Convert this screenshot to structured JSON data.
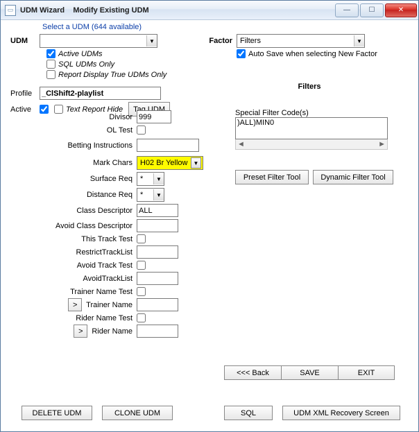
{
  "window": {
    "app_name": "UDM Wizard",
    "subtitle": "Modify Existing UDM"
  },
  "header": {
    "select_link": "Select a UDM (644 available)",
    "udm_label": "UDM",
    "factor_label": "Factor",
    "factor_value": "Filters",
    "udm_value": ""
  },
  "chk_opts": {
    "active_udms": "Active UDMs",
    "sql_only": "SQL UDMs Only",
    "report_display": "Report Display True UDMs Only",
    "autosave": "Auto Save when selecting New Factor"
  },
  "profile": {
    "label": "Profile",
    "value": "_ClShift2-playlist"
  },
  "active": {
    "label": "Active",
    "text_report_hide": "Text Report Hide",
    "tag_btn": "Tag UDM"
  },
  "filters_panel": {
    "title": "Filters",
    "special_label": "Special Filter Code(s)",
    "special_value": ")ALL)MIN0",
    "preset_btn": "Preset Filter Tool",
    "dynamic_btn": "Dynamic Filter Tool"
  },
  "fields": {
    "divisor_label": "Divisor",
    "divisor_value": "999",
    "ol_test_label": "OL Test",
    "betting_label": "Betting Instructions",
    "betting_value": "",
    "mark_label": "Mark Chars",
    "mark_value": "H02 Br Yellow",
    "surface_label": "Surface Req",
    "surface_value": "*",
    "distance_label": "Distance Req",
    "distance_value": "*",
    "class_label": "Class Descriptor",
    "class_value": "ALL",
    "avoid_class_label": "Avoid Class Descriptor",
    "avoid_class_value": "",
    "this_track_label": "This Track Test",
    "restrict_list_label": "RestrictTrackList",
    "restrict_list_value": "",
    "avoid_track_label": "Avoid Track Test",
    "avoid_tracklist_label": "AvoidTrackList",
    "avoid_tracklist_value": "",
    "trainer_test_label": "Trainer Name Test",
    "trainer_name_label": "Trainer Name",
    "trainer_name_value": "",
    "rider_test_label": "Rider Name Test",
    "rider_name_label": "Rider Name",
    "rider_name_value": "",
    "expand": ">"
  },
  "nav": {
    "back": "<<<  Back",
    "save": "SAVE",
    "exit": "EXIT"
  },
  "bottom": {
    "delete": "DELETE UDM",
    "clone": "CLONE UDM",
    "sql": "SQL",
    "recovery": "UDM XML Recovery Screen"
  }
}
